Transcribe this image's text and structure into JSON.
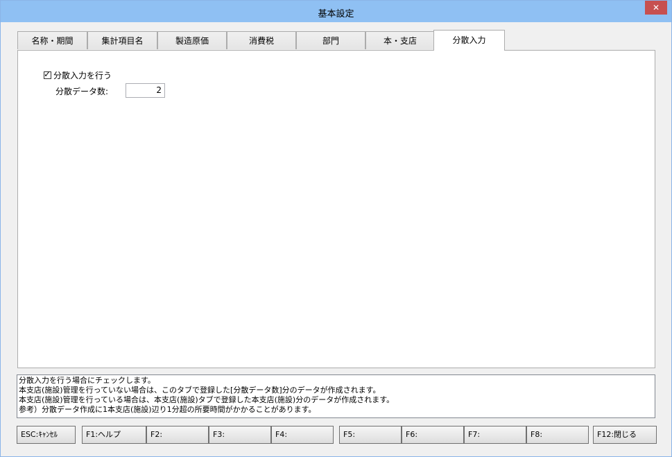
{
  "window": {
    "title": "基本設定",
    "close_glyph": "✕"
  },
  "tabs": [
    {
      "label": "名称・期間"
    },
    {
      "label": "集計項目名"
    },
    {
      "label": "製造原価"
    },
    {
      "label": "消費税"
    },
    {
      "label": "部門"
    },
    {
      "label": "本・支店"
    },
    {
      "label": "分散入力",
      "active": true
    }
  ],
  "panel": {
    "checkbox_label": "分散入力を行う",
    "checkbox_checked": true,
    "checkbox_mark": "✓",
    "count_label": "分散データ数:",
    "count_value": "2"
  },
  "help": {
    "lines": [
      "分散入力を行う場合にチェックします。",
      "本支店(施設)管理を行っていない場合は、このタブで登録した[分散データ数]分のデータが作成されます。",
      "本支店(施設)管理を行っている場合は、本支店(施設)タブで登録した本支店(施設)分のデータが作成されます。",
      "参考）分散データ作成に1本支店(施設)辺り1分超の所要時間がかかることがあります。"
    ]
  },
  "fkeys": [
    {
      "label": "ESC:ｷｬﾝｾﾙ"
    },
    {
      "label": "F1:ヘルプ"
    },
    {
      "label": "F2:"
    },
    {
      "label": "F3:"
    },
    {
      "label": "F4:"
    },
    {
      "label": "F5:"
    },
    {
      "label": "F6:"
    },
    {
      "label": "F7:"
    },
    {
      "label": "F8:"
    },
    {
      "label": "F12:閉じる"
    }
  ],
  "colors": {
    "titlebar": "#8fc0f3",
    "close_button": "#c75050"
  }
}
